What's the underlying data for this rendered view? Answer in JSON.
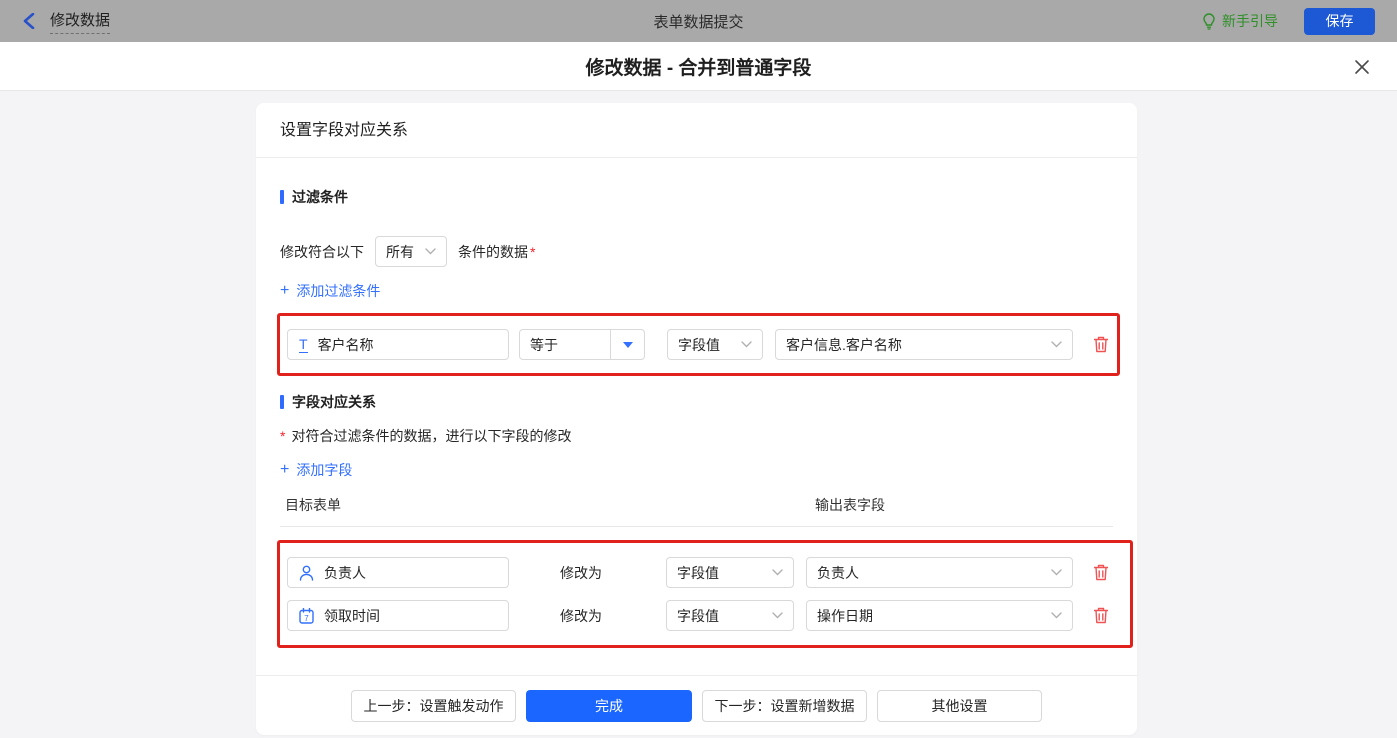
{
  "topbar": {
    "back_label": "修改数据",
    "center_title": "表单数据提交",
    "guide_label": "新手引导",
    "save_label": "保存"
  },
  "dialog": {
    "title": "修改数据 - 合并到普通字段"
  },
  "card": {
    "header": "设置字段对应关系",
    "filter_section": {
      "title": "过滤条件",
      "match_prefix": "修改符合以下",
      "match_select_value": "所有",
      "match_suffix": "条件的数据",
      "required_mark": "*",
      "add_plus": "+",
      "add_link": "添加过滤条件",
      "condition": {
        "field": "客户名称",
        "field_icon": "T",
        "operator": "等于",
        "value_type": "字段值",
        "value": "客户信息.客户名称"
      }
    },
    "mapping_section": {
      "title": "字段对应关系",
      "required_mark": "*",
      "description": "对符合过滤条件的数据，进行以下字段的修改",
      "add_plus": "+",
      "add_link": "添加字段",
      "col_target": "目标表单",
      "col_output": "输出表字段",
      "modify_label": "修改为",
      "rows": [
        {
          "field": "负责人",
          "value_type": "字段值",
          "value": "负责人"
        },
        {
          "field": "领取时间",
          "value_type": "字段值",
          "value": "操作日期"
        }
      ]
    },
    "footer": {
      "prev_label": "上一步：设置触发动作",
      "done_label": "完成",
      "next_label": "下一步：设置新增数据",
      "other_label": "其他设置"
    }
  },
  "colors": {
    "accent_blue": "#2f6bff",
    "link_blue": "#3370ff",
    "primary_button_blue": "#1a66ff",
    "save_button_blue": "#1d59d4",
    "highlight_red": "#e1211b",
    "danger_red": "#f05353",
    "required_red": "#f5222d",
    "guide_green": "#2f8f28",
    "topbar_dimmed_gray": "#a9a9a9"
  }
}
